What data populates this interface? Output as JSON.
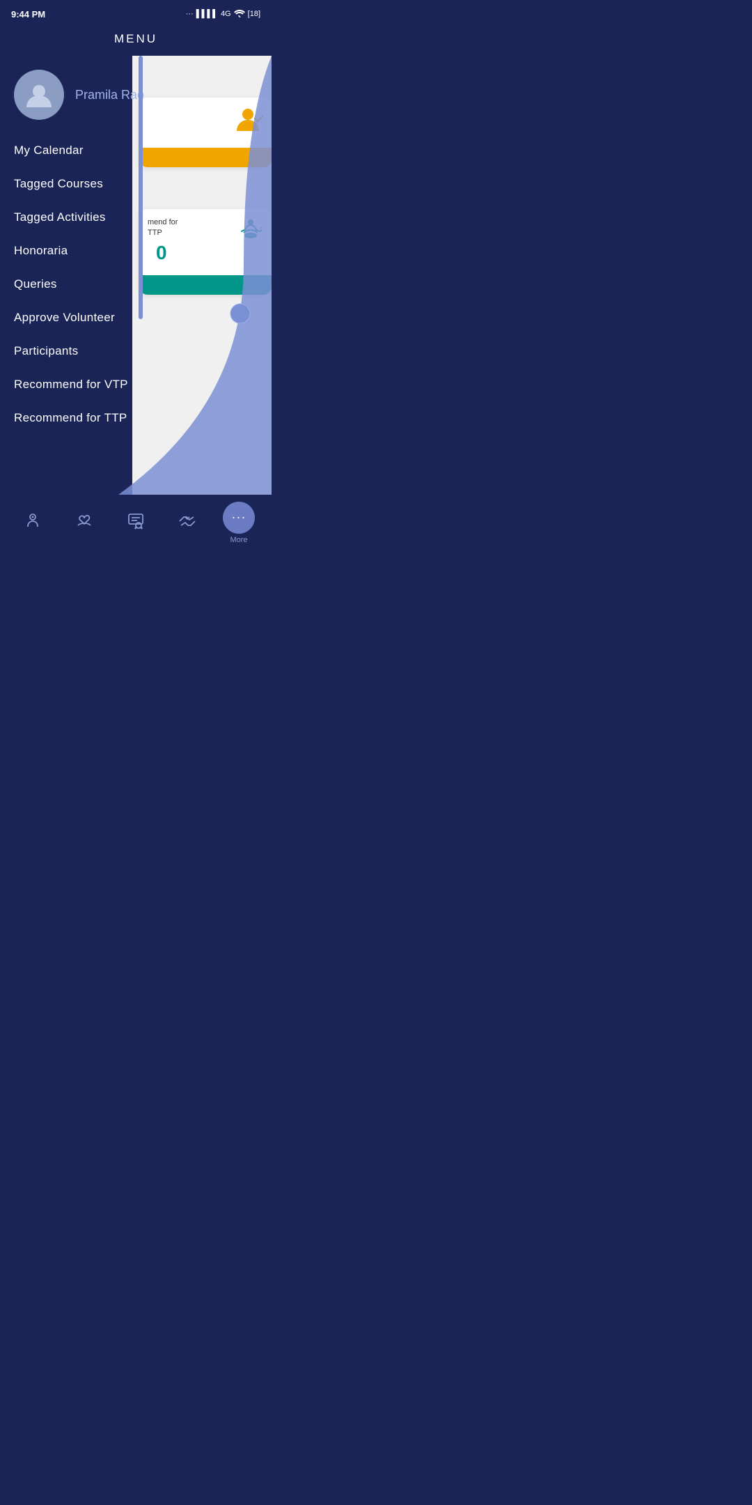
{
  "status_bar": {
    "time": "9:44 PM",
    "network": "4G",
    "battery": "18"
  },
  "header": {
    "title": "MENU"
  },
  "profile": {
    "name": "Pramila Rao"
  },
  "menu_items": [
    {
      "id": "my-calendar",
      "label": "My Calendar"
    },
    {
      "id": "tagged-courses",
      "label": "Tagged Courses"
    },
    {
      "id": "tagged-activities",
      "label": "Tagged Activities"
    },
    {
      "id": "honoraria",
      "label": "Honoraria"
    },
    {
      "id": "queries",
      "label": "Queries"
    },
    {
      "id": "approve-volunteer",
      "label": "Approve Volunteer"
    },
    {
      "id": "participants",
      "label": "Participants"
    },
    {
      "id": "recommend-vtp",
      "label": "Recommend for VTP"
    },
    {
      "id": "recommend-ttp",
      "label": "Recommend for TTP"
    }
  ],
  "cards": {
    "volunteer": {
      "icon": "👤✓"
    },
    "vtp": {
      "text": "mend for\nTTP",
      "count": "0"
    }
  },
  "bottom_nav": {
    "items": [
      {
        "id": "home",
        "icon": "⊕",
        "label": ""
      },
      {
        "id": "heart",
        "icon": "♡",
        "label": ""
      },
      {
        "id": "certificate",
        "icon": "📋",
        "label": ""
      },
      {
        "id": "handshake",
        "icon": "🤝",
        "label": ""
      }
    ],
    "more_label": "More"
  }
}
